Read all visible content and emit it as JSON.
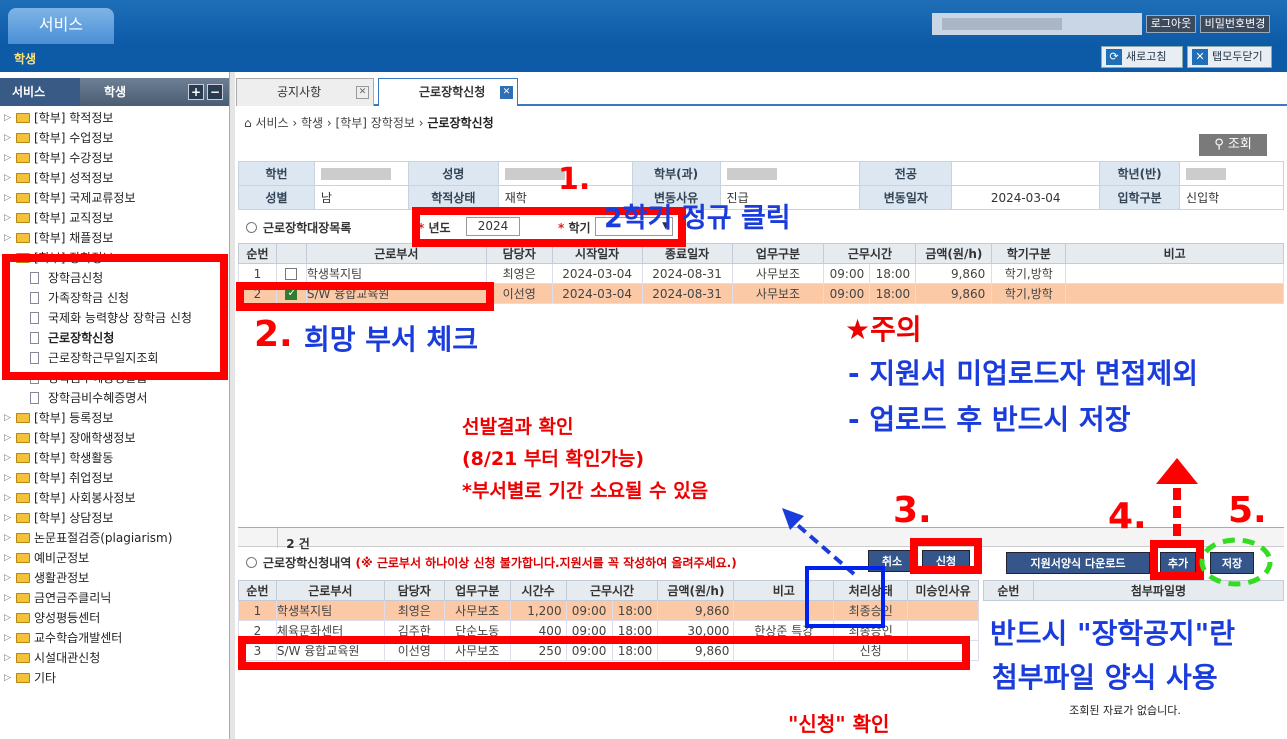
{
  "header": {
    "service_tab": "서비스",
    "logout": "로그아웃",
    "change_password": "비밀번호변경",
    "role": "학생",
    "refresh": "새로고침",
    "close_all_tabs": "탭모두닫기"
  },
  "sidebar": {
    "head_service": "서비스",
    "head_student": "학생",
    "plus": "+",
    "minus": "−",
    "items": [
      "[학부] 학적정보",
      "[학부] 수업정보",
      "[학부] 수강정보",
      "[학부] 성적정보",
      "[학부] 국제교류정보",
      "[학부] 교직정보",
      "[학부] 채플정보",
      "[학부] 장학정보",
      "장학금신청",
      "가족장학금 신청",
      "국제화 능력향상 장학금 신청",
      "근로장학신청",
      "근로장학근무일지조회",
      "장학금수혜증명발급",
      "장학금비수혜증명서",
      "[학부] 등록정보",
      "[학부] 장애학생정보",
      "[학부] 학생활동",
      "[학부] 취업정보",
      "[학부] 사회봉사정보",
      "[학부] 상담정보",
      "논문표절검증(plagiarism)",
      "예비군정보",
      "생활관정보",
      "금연금주클리닉",
      "양성평등센터",
      "교수학습개발센터",
      "시설대관신청",
      "기타"
    ]
  },
  "tabs": [
    "공지사항",
    "근로장학신청"
  ],
  "breadcrumb": {
    "parts": "서비스 › 학생 › [학부] 장학정보 ›",
    "current": "근로장학신청"
  },
  "search_button": "조회",
  "info": {
    "labels": [
      "학번",
      "성명",
      "학부(과)",
      "전공",
      "학년(반)",
      "성별",
      "학적상태",
      "변동사유",
      "변동일자",
      "입학구분"
    ],
    "gender": "남",
    "status": "재학",
    "change_reason": "진급",
    "change_date": "2024-03-04",
    "admission": "신입학"
  },
  "list1": {
    "title": "근로장학대장목록",
    "year_label": "년도",
    "year": "2024",
    "semester_label": "학기",
    "headers": [
      "순번",
      "",
      "근로부서",
      "담당자",
      "시작일자",
      "종료일자",
      "업무구분",
      "근무시간",
      "",
      "금액(원/h)",
      "학기구분",
      "비고"
    ],
    "rows": [
      [
        "1",
        "",
        "학생복지팀",
        "최영은",
        "2024-03-04",
        "2024-08-31",
        "사무보조",
        "09:00",
        "18:00",
        "9,860",
        "학기,방학",
        ""
      ],
      [
        "2",
        "",
        "S/W 융합교육원",
        "이선영",
        "2024-03-04",
        "2024-08-31",
        "사무보조",
        "09:00",
        "18:00",
        "9,860",
        "학기,방학",
        ""
      ]
    ],
    "count": "2 건"
  },
  "list2": {
    "title": "근로장학신청내역",
    "note": "(※ 근로부서 하나이상 신청 불가합니다.지원서를 꼭 작성하여 올려주세요.)",
    "cancel": "취소",
    "apply": "신청",
    "download": "지원서양식 다운로드",
    "add": "추가",
    "save": "저장",
    "headers": [
      "순번",
      "근로부서",
      "담당자",
      "업무구분",
      "시간수",
      "근무시간",
      "",
      "금액(원/h)",
      "비고",
      "처리상태",
      "미승인사유"
    ],
    "rows": [
      [
        "1",
        "학생복지팀",
        "최영은",
        "사무보조",
        "1,200",
        "09:00",
        "18:00",
        "9,860",
        "",
        "최종승인",
        ""
      ],
      [
        "2",
        "체육문화센터",
        "김주한",
        "단순노동",
        "400",
        "09:00",
        "18:00",
        "30,000",
        "한상준 특강",
        "최종승인",
        ""
      ],
      [
        "3",
        "S/W 융합교육원",
        "이선영",
        "사무보조",
        "250",
        "09:00",
        "18:00",
        "9,860",
        "",
        "신청",
        ""
      ]
    ],
    "file_headers": [
      "순번",
      "첨부파일명"
    ],
    "no_data": "조회된 자료가 없습니다."
  },
  "annotations": {
    "step1_num": "1.",
    "step1_text": "2학기 정규 클릭",
    "step2_num": "2.",
    "step2_text": "희망 부서 체크",
    "step3": "3.",
    "step4": "4.",
    "step5": "5.",
    "caution_title": "★주의",
    "caution1": "- 지원서 미업로드자 면접제외",
    "caution2": "- 업로드 후 반드시 저장",
    "result1": "선발결과 확인",
    "result2": "(8/21 부터 확인가능)",
    "result3": "*부서별로 기간 소요될 수 있음",
    "form1": "반드시 \"장학공지\"란",
    "form2": "첨부파일 양식 사용",
    "confirm": "\"신청\" 확인"
  },
  "colors": {
    "accent": "#0d5aa7",
    "highlight_row": "#fbc9a6",
    "annotation_red": "#ff0000",
    "annotation_blue": "#1a3cdb"
  }
}
